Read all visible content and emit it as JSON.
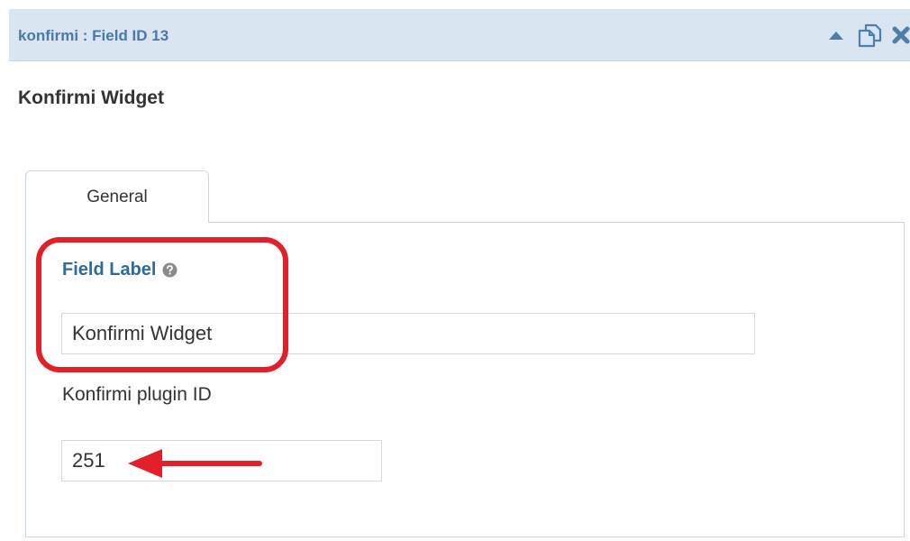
{
  "header": {
    "title": "konfirmi : Field ID 13",
    "icons": [
      "collapse-icon",
      "copy-icon",
      "close-icon"
    ]
  },
  "widget": {
    "title": "Konfirmi Widget"
  },
  "tabs": [
    {
      "label": "General",
      "active": true
    }
  ],
  "form": {
    "field_label": {
      "label": "Field Label",
      "value": "Konfirmi Widget"
    },
    "plugin_id": {
      "label": "Konfirmi plugin ID",
      "value": "251"
    }
  },
  "colors": {
    "header_bg": "#d9e6f2",
    "header_text": "#4a78a8",
    "label_blue": "#2d6c9c",
    "annotation_red": "#e2202a"
  }
}
